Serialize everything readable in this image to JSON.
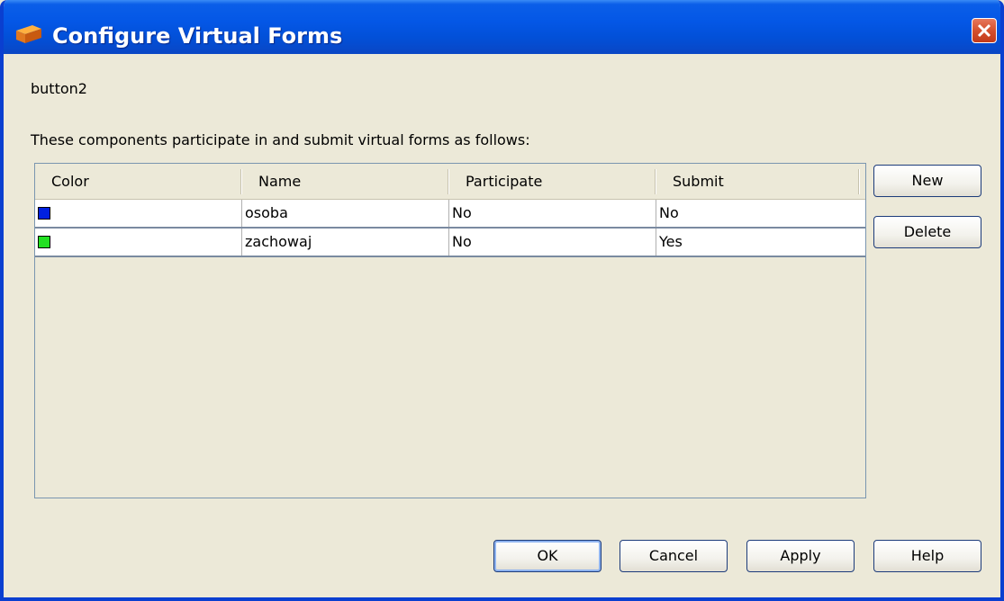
{
  "window": {
    "title": "Configure Virtual Forms"
  },
  "component_name": "button2",
  "description": "These components participate in and submit virtual forms as follows:",
  "table": {
    "columns": [
      "Color",
      "Name",
      "Participate",
      "Submit"
    ],
    "rows": [
      {
        "color": "#0020e0",
        "name": "osoba",
        "participate": "No",
        "submit": "No"
      },
      {
        "color": "#22e022",
        "name": "zachowaj",
        "participate": "No",
        "submit": "Yes"
      }
    ]
  },
  "side_buttons": {
    "new": "New",
    "delete": "Delete"
  },
  "footer_buttons": {
    "ok": "OK",
    "cancel": "Cancel",
    "apply": "Apply",
    "help": "Help"
  },
  "icons": {
    "title": "cube-icon",
    "close": "close-icon"
  }
}
